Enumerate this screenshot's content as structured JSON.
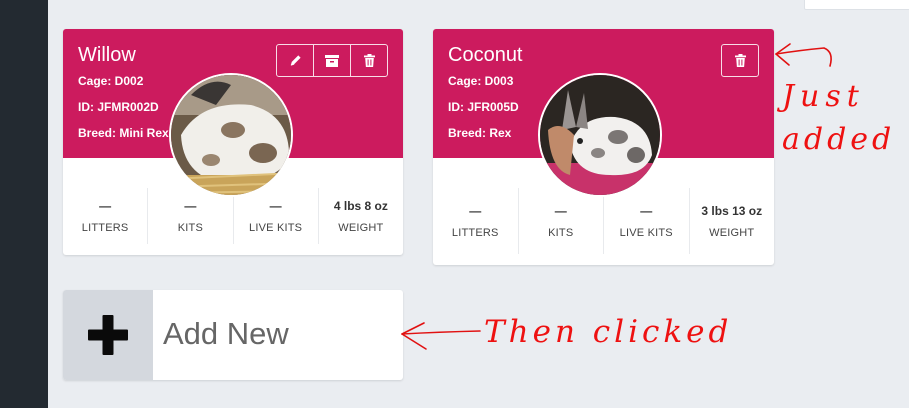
{
  "colors": {
    "accent": "#cc1b5e",
    "annotation": "#e11111",
    "sidebar": "#232a31"
  },
  "cards": [
    {
      "name": "Willow",
      "cage": "Cage: D002",
      "id": "ID: JFMR002D",
      "breed": "Breed: Mini Rex",
      "actions": [
        "edit-icon",
        "archive-icon",
        "trash-icon"
      ],
      "stats": [
        {
          "value": "—",
          "label": "LITTERS"
        },
        {
          "value": "—",
          "label": "KITS"
        },
        {
          "value": "—",
          "label": "LIVE KITS"
        },
        {
          "value": "4 lbs 8 oz",
          "label": "WEIGHT"
        }
      ]
    },
    {
      "name": "Coconut",
      "cage": "Cage: D003",
      "id": "ID: JFR005D",
      "breed": "Breed: Rex",
      "actions": [
        "trash-icon"
      ],
      "stats": [
        {
          "value": "—",
          "label": "LITTERS"
        },
        {
          "value": "—",
          "label": "KITS"
        },
        {
          "value": "—",
          "label": "LIVE KITS"
        },
        {
          "value": "3 lbs 13 oz",
          "label": "WEIGHT"
        }
      ]
    }
  ],
  "add_new": {
    "label": "Add New",
    "icon": "plus-icon"
  },
  "annotations": {
    "just": "Just",
    "added": "added",
    "then_clicked": "Then clicked"
  }
}
